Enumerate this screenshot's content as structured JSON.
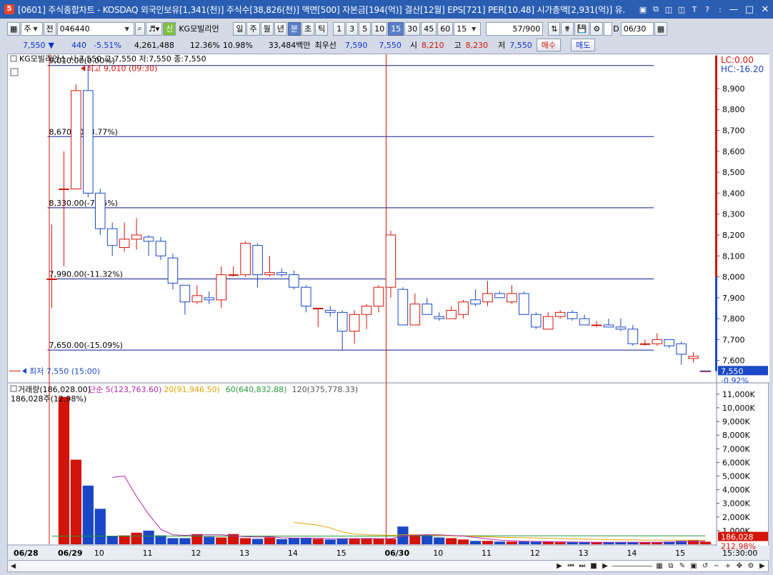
{
  "window": {
    "title": "[0601] 주식종합차트 - KOSDAQ 외국인보유[1,341(천)] 주식수[38,826(천)] 액면[500] 자본금[194(억)] 결산[12월] EPS[721] PER[10.48] 시가총액[2,931(억)] 유.",
    "icon_label": "5"
  },
  "toolbar": {
    "market": "주",
    "mode": "전",
    "code": "046440",
    "badge": "신",
    "stock_name": "KG모빌리언",
    "periods": [
      "일",
      "주",
      "월",
      "년",
      "분",
      "초",
      "틱"
    ],
    "active_period": "분",
    "minute_options": [
      "1",
      "3",
      "5",
      "10",
      "15",
      "30",
      "45",
      "60"
    ],
    "active_minute": "15",
    "minute_select": "15",
    "count": "57",
    "count_total": "/900",
    "date_check": "D",
    "date": "06/30"
  },
  "quote": {
    "price": "7,550",
    "change_arrow": "▼",
    "change": "440",
    "change_pct": "-5.51%",
    "volume": "4,261,488",
    "turnover_pct": "12.36%",
    "vol_ratio": "10.98%",
    "amount": "33,484백만",
    "priority_label": "최우선",
    "bid": "7,590",
    "ask": "7,550",
    "open_label": "시",
    "open": "8,210",
    "high_label": "고",
    "high": "8,230",
    "low_label": "저",
    "low": "7,550",
    "buy": "매수",
    "sell": "매도"
  },
  "colors": {
    "up": "#d2140a",
    "down": "#1a47c6",
    "hline": "#0a1a8c",
    "ma5": "#b02cb0",
    "ma20": "#e0a300",
    "ma60": "#2a9a3a",
    "ma120": "#9a9a9a"
  },
  "chart_data": {
    "type": "candlestick",
    "title": "",
    "price_legend": "KG모빌리언스 시:7,550 고:7,550 저:7,550 종:7,550",
    "price_axis": {
      "min": 7500,
      "max": 9050,
      "ticks": [
        "8,900",
        "8,800",
        "8,700",
        "8,600",
        "8,500",
        "8,400",
        "8,300",
        "8,200",
        "8,100",
        "8,000",
        "7,900",
        "7,800",
        "7,700",
        "7,600"
      ],
      "tick_values": [
        8900,
        8800,
        8700,
        8600,
        8500,
        8400,
        8300,
        8200,
        8100,
        8000,
        7900,
        7800,
        7700,
        7600
      ]
    },
    "lc_label": "LC:0.00",
    "hc_label": "HC:-16.20",
    "last_price_label": "7,550",
    "last_pct_label": "-0.92%",
    "horizontal_lines": [
      {
        "value": 9010,
        "label": "9,010.00(0.00%)"
      },
      {
        "value": 8670,
        "label": "8,670.00(-3.77%)"
      },
      {
        "value": 8330,
        "label": "8,330.00(-7.55%)"
      },
      {
        "value": 7990,
        "label": "7,990.00(-11.32%)"
      },
      {
        "value": 7650,
        "label": "7,650.00(-15.09%)"
      }
    ],
    "high_marker": {
      "value": 9010,
      "label": "최고 9,010 (09:30)"
    },
    "low_marker": {
      "value": 7550,
      "label": "최저 7,550 (15:00)"
    },
    "candles": [
      {
        "o": 7990,
        "h": 8250,
        "l": 7850,
        "c": 7990
      },
      {
        "o": 8420,
        "h": 8600,
        "l": 8050,
        "c": 8420
      },
      {
        "o": 8420,
        "h": 8920,
        "l": 8420,
        "c": 8890
      },
      {
        "o": 8890,
        "h": 9010,
        "l": 8380,
        "c": 8400
      },
      {
        "o": 8400,
        "h": 8420,
        "l": 8200,
        "c": 8230
      },
      {
        "o": 8230,
        "h": 8260,
        "l": 8100,
        "c": 8150
      },
      {
        "o": 8140,
        "h": 8260,
        "l": 8120,
        "c": 8180
      },
      {
        "o": 8180,
        "h": 8280,
        "l": 8130,
        "c": 8200
      },
      {
        "o": 8190,
        "h": 8200,
        "l": 8100,
        "c": 8170
      },
      {
        "o": 8170,
        "h": 8190,
        "l": 8080,
        "c": 8100
      },
      {
        "o": 8090,
        "h": 8110,
        "l": 7940,
        "c": 7970
      },
      {
        "o": 7960,
        "h": 7960,
        "l": 7820,
        "c": 7880
      },
      {
        "o": 7880,
        "h": 7960,
        "l": 7870,
        "c": 7910
      },
      {
        "o": 7900,
        "h": 7930,
        "l": 7870,
        "c": 7890
      },
      {
        "o": 7890,
        "h": 8050,
        "l": 7850,
        "c": 8010
      },
      {
        "o": 8010,
        "h": 8050,
        "l": 8000,
        "c": 8010
      },
      {
        "o": 8010,
        "h": 8170,
        "l": 8000,
        "c": 8160
      },
      {
        "o": 8150,
        "h": 8160,
        "l": 7950,
        "c": 8010
      },
      {
        "o": 8010,
        "h": 8100,
        "l": 8000,
        "c": 8020
      },
      {
        "o": 8020,
        "h": 8040,
        "l": 8000,
        "c": 8010
      },
      {
        "o": 8010,
        "h": 8030,
        "l": 7940,
        "c": 7950
      },
      {
        "o": 7950,
        "h": 7960,
        "l": 7830,
        "c": 7860
      },
      {
        "o": 7850,
        "h": 7850,
        "l": 7760,
        "c": 7850
      },
      {
        "o": 7840,
        "h": 7860,
        "l": 7810,
        "c": 7830
      },
      {
        "o": 7830,
        "h": 7840,
        "l": 7650,
        "c": 7740
      },
      {
        "o": 7740,
        "h": 7840,
        "l": 7680,
        "c": 7820
      },
      {
        "o": 7820,
        "h": 7870,
        "l": 7750,
        "c": 7860
      },
      {
        "o": 7860,
        "h": 7960,
        "l": 7830,
        "c": 7950
      },
      {
        "o": 7950,
        "h": 8220,
        "l": 7900,
        "c": 8200
      },
      {
        "o": 7940,
        "h": 7950,
        "l": 7770,
        "c": 7770
      },
      {
        "o": 7770,
        "h": 7920,
        "l": 7770,
        "c": 7870
      },
      {
        "o": 7870,
        "h": 7900,
        "l": 7830,
        "c": 7820
      },
      {
        "o": 7810,
        "h": 7830,
        "l": 7790,
        "c": 7800
      },
      {
        "o": 7800,
        "h": 7860,
        "l": 7800,
        "c": 7840
      },
      {
        "o": 7820,
        "h": 7890,
        "l": 7800,
        "c": 7880
      },
      {
        "o": 7890,
        "h": 7940,
        "l": 7860,
        "c": 7870
      },
      {
        "o": 7880,
        "h": 7980,
        "l": 7860,
        "c": 7920
      },
      {
        "o": 7920,
        "h": 7930,
        "l": 7900,
        "c": 7900
      },
      {
        "o": 7880,
        "h": 7960,
        "l": 7870,
        "c": 7920
      },
      {
        "o": 7920,
        "h": 7930,
        "l": 7820,
        "c": 7820
      },
      {
        "o": 7820,
        "h": 7830,
        "l": 7750,
        "c": 7760
      },
      {
        "o": 7750,
        "h": 7830,
        "l": 7750,
        "c": 7810
      },
      {
        "o": 7810,
        "h": 7840,
        "l": 7800,
        "c": 7830
      },
      {
        "o": 7830,
        "h": 7840,
        "l": 7790,
        "c": 7800
      },
      {
        "o": 7800,
        "h": 7820,
        "l": 7780,
        "c": 7770
      },
      {
        "o": 7770,
        "h": 7790,
        "l": 7760,
        "c": 7770
      },
      {
        "o": 7770,
        "h": 7800,
        "l": 7760,
        "c": 7760
      },
      {
        "o": 7760,
        "h": 7800,
        "l": 7740,
        "c": 7750
      },
      {
        "o": 7750,
        "h": 7770,
        "l": 7670,
        "c": 7680
      },
      {
        "o": 7680,
        "h": 7700,
        "l": 7670,
        "c": 7680
      },
      {
        "o": 7680,
        "h": 7730,
        "l": 7670,
        "c": 7700
      },
      {
        "o": 7700,
        "h": 7700,
        "l": 7660,
        "c": 7670
      },
      {
        "o": 7680,
        "h": 7690,
        "l": 7580,
        "c": 7630
      },
      {
        "o": 7610,
        "h": 7640,
        "l": 7590,
        "c": 7620
      },
      {
        "o": 7550,
        "h": 7550,
        "l": 7550,
        "c": 7550
      }
    ],
    "volume_legend": {
      "vol": "거래량(186,028.00)",
      "ma5": "단순 5(123,763.60)",
      "ma20": "20(91,946.50)",
      "ma60": "60(640,832.88)",
      "ma120": "120(375,778.33)",
      "sub": "186,028주(12.98%)"
    },
    "volume_axis": {
      "max": 11200,
      "ticks": [
        "11,000K",
        "10,000K",
        "9,000K",
        "8,000K",
        "7,000K",
        "6,000K",
        "5,000K",
        "4,000K",
        "3,000K",
        "2,000K",
        "1,000K"
      ],
      "tick_values": [
        11000,
        10000,
        9000,
        8000,
        7000,
        6000,
        5000,
        4000,
        3000,
        2000,
        1000
      ]
    },
    "last_volume_label": "186,028",
    "last_volume_pct": "212.98%",
    "volumes": [
      0,
      10800,
      6200,
      4300,
      2600,
      600,
      650,
      850,
      1000,
      650,
      450,
      450,
      750,
      550,
      500,
      750,
      450,
      400,
      500,
      380,
      450,
      480,
      400,
      350,
      400,
      400,
      450,
      420,
      400,
      1300,
      700,
      700,
      500,
      450,
      350,
      250,
      250,
      200,
      200,
      200,
      180,
      180,
      150,
      150,
      150,
      150,
      150,
      150,
      150,
      150,
      150,
      200,
      250,
      300,
      186
    ],
    "ma5": [
      null,
      null,
      null,
      null,
      null,
      4900,
      5000,
      3500,
      2200,
      1100,
      700,
      650,
      700,
      700,
      700,
      620,
      560,
      530,
      550,
      480,
      460,
      450,
      450,
      420,
      410,
      420,
      420,
      410,
      410,
      600,
      650,
      700,
      700,
      650,
      600,
      500,
      400,
      300,
      260,
      230,
      210,
      200,
      180,
      170,
      160,
      150,
      150,
      150,
      150,
      150,
      150,
      160,
      180,
      210,
      230
    ],
    "ma20": [
      null,
      null,
      null,
      null,
      null,
      null,
      null,
      null,
      null,
      null,
      null,
      null,
      null,
      null,
      null,
      null,
      null,
      null,
      null,
      null,
      1600,
      1500,
      1400,
      1200,
      900,
      750,
      700,
      680,
      650,
      700,
      700,
      700,
      650,
      620,
      600,
      580,
      550,
      520,
      500,
      480,
      460,
      440,
      420,
      400,
      380,
      360,
      340,
      330,
      320,
      310,
      300,
      300,
      300,
      300,
      300
    ],
    "ma60": [
      600,
      600,
      600,
      600,
      600,
      600,
      600,
      600,
      600,
      600,
      600,
      600,
      600,
      600,
      600,
      600,
      600,
      600,
      600,
      600,
      600,
      600,
      600,
      600,
      600,
      600,
      600,
      600,
      600,
      600,
      620,
      620,
      620,
      620,
      620,
      620,
      620,
      620,
      620,
      620,
      620,
      620,
      620,
      620,
      620,
      620,
      620,
      620,
      620,
      620,
      620,
      620,
      620,
      620,
      620
    ],
    "x_labels": [
      {
        "i": 0,
        "label": "06/28"
      },
      {
        "i": 1,
        "label": "06/29"
      },
      {
        "i": 4,
        "label": "10"
      },
      {
        "i": 8,
        "label": "11"
      },
      {
        "i": 12,
        "label": "12"
      },
      {
        "i": 16,
        "label": "13"
      },
      {
        "i": 20,
        "label": "14"
      },
      {
        "i": 24,
        "label": "15"
      },
      {
        "i": 28,
        "label": "06/30"
      },
      {
        "i": 32,
        "label": "10"
      },
      {
        "i": 36,
        "label": "11"
      },
      {
        "i": 40,
        "label": "12"
      },
      {
        "i": 44,
        "label": "13"
      },
      {
        "i": 48,
        "label": "14"
      },
      {
        "i": 52,
        "label": "15"
      }
    ],
    "time_label": "15:30:00"
  }
}
